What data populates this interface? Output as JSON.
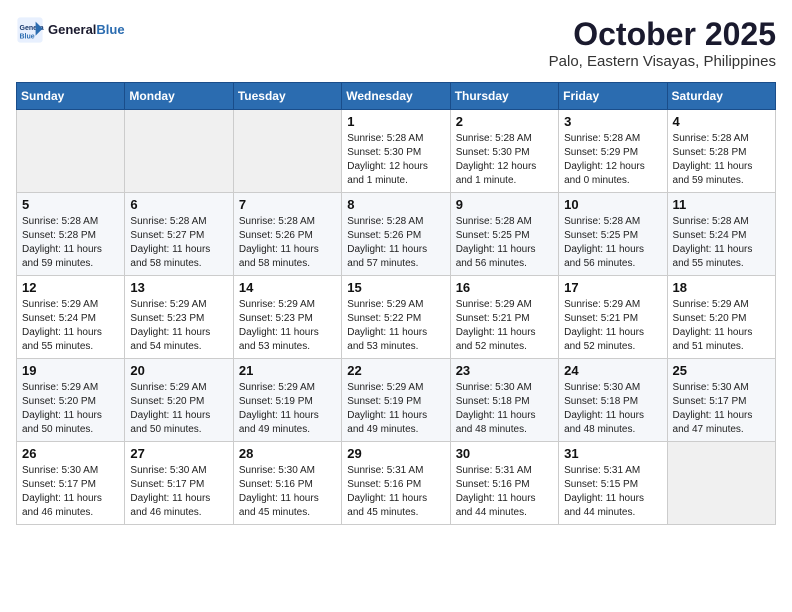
{
  "header": {
    "logo_general": "General",
    "logo_blue": "Blue",
    "month": "October 2025",
    "location": "Palo, Eastern Visayas, Philippines"
  },
  "weekdays": [
    "Sunday",
    "Monday",
    "Tuesday",
    "Wednesday",
    "Thursday",
    "Friday",
    "Saturday"
  ],
  "weeks": [
    [
      {
        "day": "",
        "sunrise": "",
        "sunset": "",
        "daylight": ""
      },
      {
        "day": "",
        "sunrise": "",
        "sunset": "",
        "daylight": ""
      },
      {
        "day": "",
        "sunrise": "",
        "sunset": "",
        "daylight": ""
      },
      {
        "day": "1",
        "sunrise": "Sunrise: 5:28 AM",
        "sunset": "Sunset: 5:30 PM",
        "daylight": "Daylight: 12 hours and 1 minute."
      },
      {
        "day": "2",
        "sunrise": "Sunrise: 5:28 AM",
        "sunset": "Sunset: 5:30 PM",
        "daylight": "Daylight: 12 hours and 1 minute."
      },
      {
        "day": "3",
        "sunrise": "Sunrise: 5:28 AM",
        "sunset": "Sunset: 5:29 PM",
        "daylight": "Daylight: 12 hours and 0 minutes."
      },
      {
        "day": "4",
        "sunrise": "Sunrise: 5:28 AM",
        "sunset": "Sunset: 5:28 PM",
        "daylight": "Daylight: 11 hours and 59 minutes."
      }
    ],
    [
      {
        "day": "5",
        "sunrise": "Sunrise: 5:28 AM",
        "sunset": "Sunset: 5:28 PM",
        "daylight": "Daylight: 11 hours and 59 minutes."
      },
      {
        "day": "6",
        "sunrise": "Sunrise: 5:28 AM",
        "sunset": "Sunset: 5:27 PM",
        "daylight": "Daylight: 11 hours and 58 minutes."
      },
      {
        "day": "7",
        "sunrise": "Sunrise: 5:28 AM",
        "sunset": "Sunset: 5:26 PM",
        "daylight": "Daylight: 11 hours and 58 minutes."
      },
      {
        "day": "8",
        "sunrise": "Sunrise: 5:28 AM",
        "sunset": "Sunset: 5:26 PM",
        "daylight": "Daylight: 11 hours and 57 minutes."
      },
      {
        "day": "9",
        "sunrise": "Sunrise: 5:28 AM",
        "sunset": "Sunset: 5:25 PM",
        "daylight": "Daylight: 11 hours and 56 minutes."
      },
      {
        "day": "10",
        "sunrise": "Sunrise: 5:28 AM",
        "sunset": "Sunset: 5:25 PM",
        "daylight": "Daylight: 11 hours and 56 minutes."
      },
      {
        "day": "11",
        "sunrise": "Sunrise: 5:28 AM",
        "sunset": "Sunset: 5:24 PM",
        "daylight": "Daylight: 11 hours and 55 minutes."
      }
    ],
    [
      {
        "day": "12",
        "sunrise": "Sunrise: 5:29 AM",
        "sunset": "Sunset: 5:24 PM",
        "daylight": "Daylight: 11 hours and 55 minutes."
      },
      {
        "day": "13",
        "sunrise": "Sunrise: 5:29 AM",
        "sunset": "Sunset: 5:23 PM",
        "daylight": "Daylight: 11 hours and 54 minutes."
      },
      {
        "day": "14",
        "sunrise": "Sunrise: 5:29 AM",
        "sunset": "Sunset: 5:23 PM",
        "daylight": "Daylight: 11 hours and 53 minutes."
      },
      {
        "day": "15",
        "sunrise": "Sunrise: 5:29 AM",
        "sunset": "Sunset: 5:22 PM",
        "daylight": "Daylight: 11 hours and 53 minutes."
      },
      {
        "day": "16",
        "sunrise": "Sunrise: 5:29 AM",
        "sunset": "Sunset: 5:21 PM",
        "daylight": "Daylight: 11 hours and 52 minutes."
      },
      {
        "day": "17",
        "sunrise": "Sunrise: 5:29 AM",
        "sunset": "Sunset: 5:21 PM",
        "daylight": "Daylight: 11 hours and 52 minutes."
      },
      {
        "day": "18",
        "sunrise": "Sunrise: 5:29 AM",
        "sunset": "Sunset: 5:20 PM",
        "daylight": "Daylight: 11 hours and 51 minutes."
      }
    ],
    [
      {
        "day": "19",
        "sunrise": "Sunrise: 5:29 AM",
        "sunset": "Sunset: 5:20 PM",
        "daylight": "Daylight: 11 hours and 50 minutes."
      },
      {
        "day": "20",
        "sunrise": "Sunrise: 5:29 AM",
        "sunset": "Sunset: 5:20 PM",
        "daylight": "Daylight: 11 hours and 50 minutes."
      },
      {
        "day": "21",
        "sunrise": "Sunrise: 5:29 AM",
        "sunset": "Sunset: 5:19 PM",
        "daylight": "Daylight: 11 hours and 49 minutes."
      },
      {
        "day": "22",
        "sunrise": "Sunrise: 5:29 AM",
        "sunset": "Sunset: 5:19 PM",
        "daylight": "Daylight: 11 hours and 49 minutes."
      },
      {
        "day": "23",
        "sunrise": "Sunrise: 5:30 AM",
        "sunset": "Sunset: 5:18 PM",
        "daylight": "Daylight: 11 hours and 48 minutes."
      },
      {
        "day": "24",
        "sunrise": "Sunrise: 5:30 AM",
        "sunset": "Sunset: 5:18 PM",
        "daylight": "Daylight: 11 hours and 48 minutes."
      },
      {
        "day": "25",
        "sunrise": "Sunrise: 5:30 AM",
        "sunset": "Sunset: 5:17 PM",
        "daylight": "Daylight: 11 hours and 47 minutes."
      }
    ],
    [
      {
        "day": "26",
        "sunrise": "Sunrise: 5:30 AM",
        "sunset": "Sunset: 5:17 PM",
        "daylight": "Daylight: 11 hours and 46 minutes."
      },
      {
        "day": "27",
        "sunrise": "Sunrise: 5:30 AM",
        "sunset": "Sunset: 5:17 PM",
        "daylight": "Daylight: 11 hours and 46 minutes."
      },
      {
        "day": "28",
        "sunrise": "Sunrise: 5:30 AM",
        "sunset": "Sunset: 5:16 PM",
        "daylight": "Daylight: 11 hours and 45 minutes."
      },
      {
        "day": "29",
        "sunrise": "Sunrise: 5:31 AM",
        "sunset": "Sunset: 5:16 PM",
        "daylight": "Daylight: 11 hours and 45 minutes."
      },
      {
        "day": "30",
        "sunrise": "Sunrise: 5:31 AM",
        "sunset": "Sunset: 5:16 PM",
        "daylight": "Daylight: 11 hours and 44 minutes."
      },
      {
        "day": "31",
        "sunrise": "Sunrise: 5:31 AM",
        "sunset": "Sunset: 5:15 PM",
        "daylight": "Daylight: 11 hours and 44 minutes."
      },
      {
        "day": "",
        "sunrise": "",
        "sunset": "",
        "daylight": ""
      }
    ]
  ]
}
